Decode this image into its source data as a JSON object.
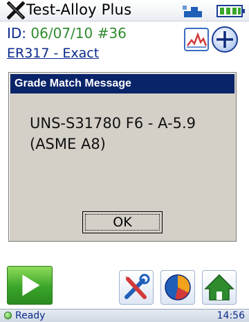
{
  "app": {
    "title": "Test-Alloy Plus"
  },
  "test": {
    "id_label": "ID:",
    "id_value": "06/07/10 #36",
    "match": "ER317 - Exact"
  },
  "dialog": {
    "title": "Grade Match Message",
    "line1": "UNS-S31780 F6 - A-5.9",
    "line2": "(ASME A8)",
    "ok_label": "OK"
  },
  "status": {
    "text": "Ready",
    "time": "14:56"
  },
  "icons": {
    "close": "x-icon",
    "signal": "signal-icon",
    "battery": "battery-icon",
    "spectrum": "spectrum-icon",
    "add": "plus-icon",
    "play": "play-icon",
    "tools": "tools-icon",
    "chart": "pie-chart-icon",
    "home": "home-icon"
  },
  "colors": {
    "accent": "#0a246a",
    "link": "#0a2a8c",
    "id_value": "#2e8b2e",
    "play": "#3aa52a"
  }
}
